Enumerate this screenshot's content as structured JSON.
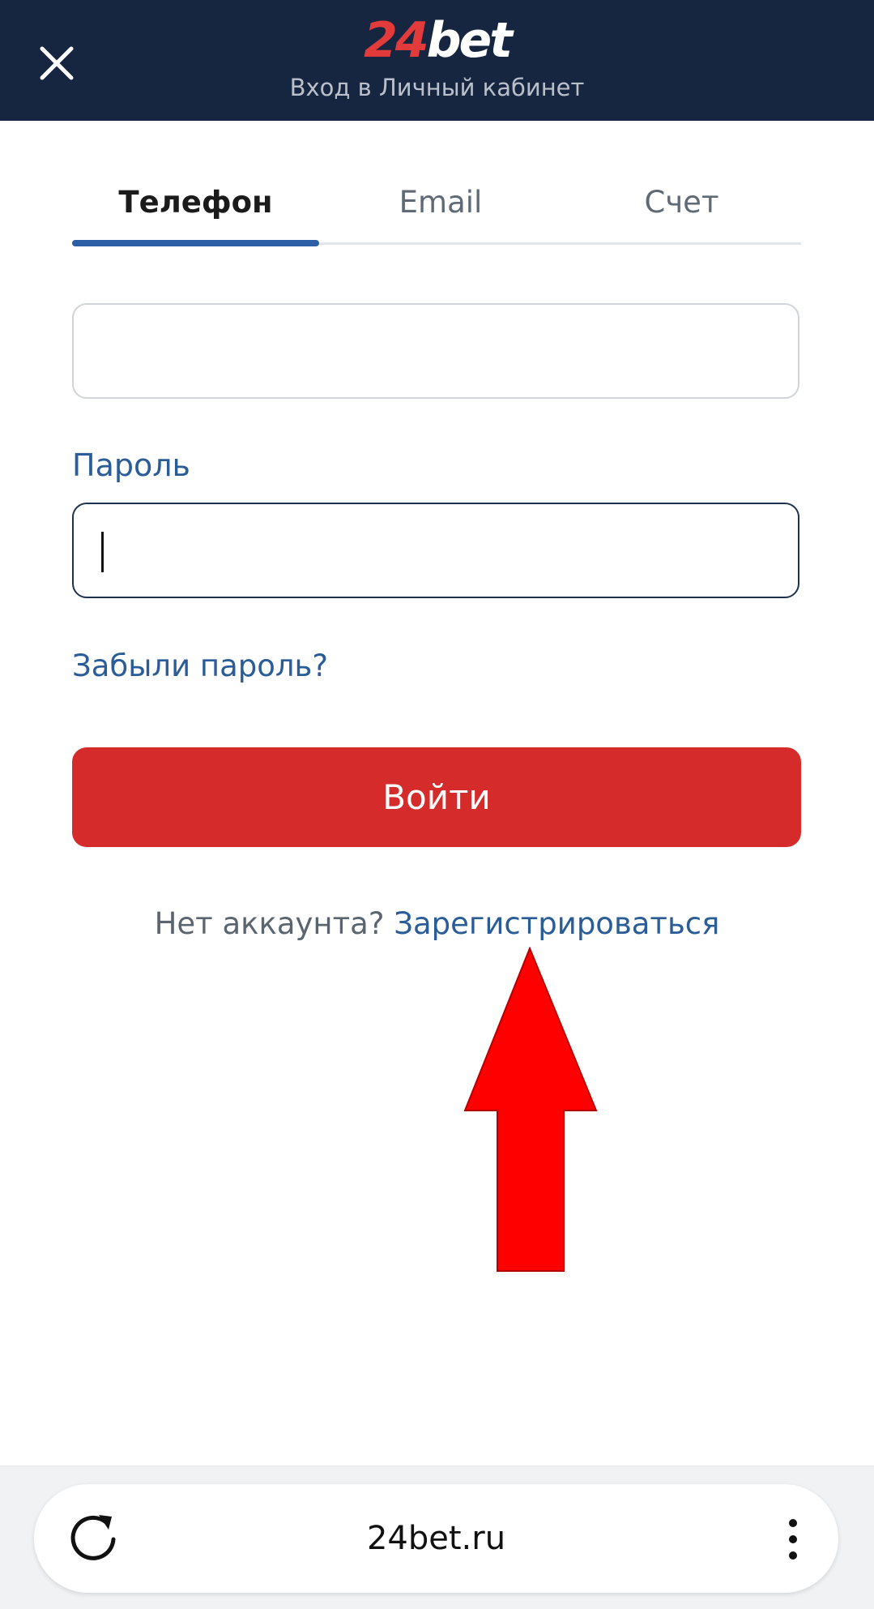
{
  "header": {
    "logo_number": "24",
    "logo_word": "bet",
    "subtitle": "Вход в Личный кабинет",
    "background_color": "#172640",
    "close_icon": "close-icon"
  },
  "tabs": [
    {
      "label": "Телефон",
      "active": true
    },
    {
      "label": "Email",
      "active": false
    },
    {
      "label": "Счет",
      "active": false
    }
  ],
  "form": {
    "phone_value": "",
    "password_label": "Пароль",
    "password_value": "",
    "forgot_link": "Забыли пароль?",
    "login_button": "Войти",
    "login_button_color": "#d62b2b"
  },
  "register": {
    "prompt": "Нет аккаунта?",
    "link": "Зарегистрироваться"
  },
  "browser": {
    "url": "24bet.ru",
    "reload_icon": "reload-icon",
    "menu_icon": "more-vertical-icon"
  },
  "annotation": {
    "arrow_color": "#ff0000"
  }
}
